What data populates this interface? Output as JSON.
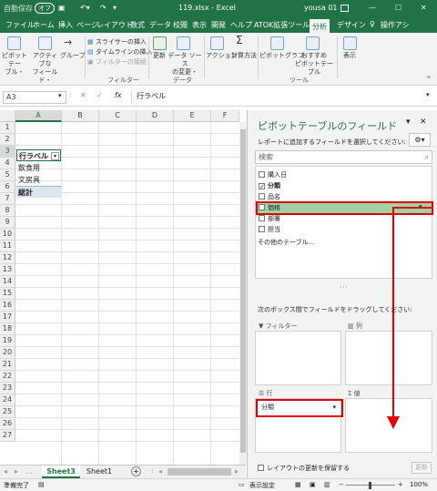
{
  "titlebar": {
    "autosave": "自動保存",
    "autosave_state": "オフ",
    "title": "119.xlsx - Excel",
    "user": "yousa 01"
  },
  "tabs": [
    "ファイル",
    "ホーム",
    "挿入",
    "ページ",
    "レイアウト",
    "数式",
    "データ",
    "校閲",
    "表示",
    "開発",
    "ヘルプ",
    "ATOK拡張ツール",
    "分析",
    "デザイン"
  ],
  "active_tab": "分析",
  "tell_me": "操作アシ",
  "ribbon": {
    "pivot_table": "ピボットテー\nブル・",
    "active_field": "アクティブな\nフィールド・",
    "group": "グループ",
    "insert_slicer": "スライサーの挿入",
    "insert_timeline": "タイムラインの挿入",
    "filter_connections": "フィルターの接続",
    "group_filter": "フィルター",
    "refresh": "更新",
    "change_source": "データ ソース\nの変更・",
    "group_data": "データ",
    "actions": "アクション",
    "calculations": "計算方法",
    "pivot_chart": "ピボットグラフ",
    "recommended": "おすすめ\nピボットテーブル",
    "group_tools": "ツール",
    "show": "表示"
  },
  "formula": {
    "namebox": "A3",
    "content": "行ラベル"
  },
  "columns": [
    "A",
    "B",
    "C",
    "D",
    "E",
    "F"
  ],
  "rows": [
    "1",
    "2",
    "3",
    "4",
    "5",
    "6",
    "7",
    "8",
    "9",
    "10",
    "11",
    "12",
    "13",
    "14",
    "15",
    "16",
    "17",
    "18",
    "19",
    "20",
    "21",
    "22",
    "23",
    "24",
    "25",
    "26",
    "27"
  ],
  "cells": {
    "a3": "行ラベル",
    "a4": "飲食用",
    "a5": "文房具",
    "a6": "総計"
  },
  "sheets": [
    "Sheet3",
    "Sheet1"
  ],
  "status": {
    "ready": "準備完了",
    "display_settings": "表示設定",
    "zoom": "100%"
  },
  "pane": {
    "title": "ピボットテーブルのフィールド",
    "subtitle": "レポートに追加するフィールドを選択してください:",
    "search_placeholder": "検索",
    "fields": [
      {
        "label": "購入日",
        "checked": false
      },
      {
        "label": "分類",
        "checked": true
      },
      {
        "label": "品名",
        "checked": false
      },
      {
        "label": "価格",
        "checked": false
      },
      {
        "label": "部署",
        "checked": false
      },
      {
        "label": "担当",
        "checked": false
      }
    ],
    "more_tables": "その他のテーブル...",
    "drag_hint": "次のボックス間でフィールドをドラッグしてください:",
    "area_filter": "フィルター",
    "area_columns": "列",
    "area_rows": "行",
    "area_values": "値",
    "row_field": "分類",
    "defer_update": "レイアウトの更新を保留する",
    "update_button": "更新"
  }
}
